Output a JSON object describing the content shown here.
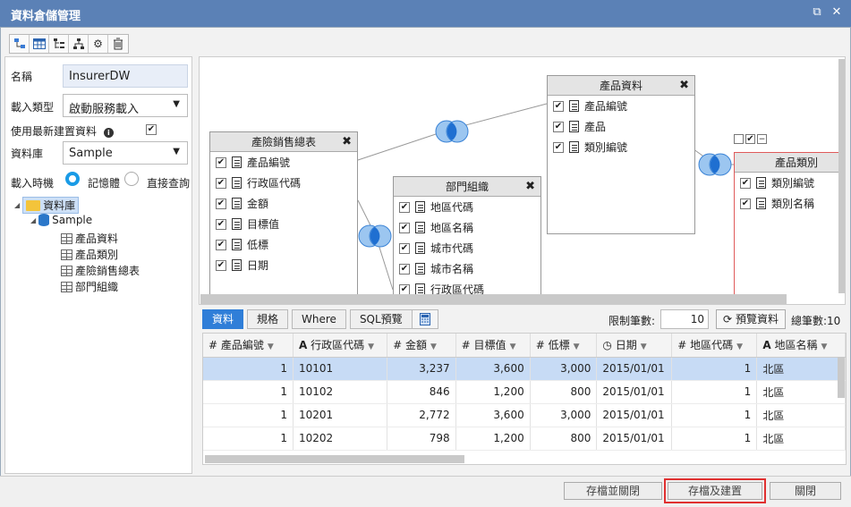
{
  "window": {
    "title": "資料倉儲管理"
  },
  "toolbar": {
    "icons": [
      "diagram-icon",
      "table-icon",
      "tree-icon",
      "hierarchy-icon",
      "gear-icon",
      "trash-icon"
    ]
  },
  "form": {
    "name_label": "名稱",
    "name_value": "InsurerDW",
    "load_type_label": "載入類型",
    "load_type_value": "啟動服務載入",
    "use_latest_label": "使用最新建置資料",
    "use_latest_checked": true,
    "database_label": "資料庫",
    "database_value": "Sample",
    "load_time_label": "載入時機",
    "radio_memory": "記憶體",
    "radio_direct": "直接查詢"
  },
  "tree": {
    "root": "資料庫",
    "db": "Sample",
    "tables": [
      "產品資料",
      "產品類別",
      "產險銷售總表",
      "部門組織"
    ]
  },
  "entities": {
    "sales": {
      "title": "產險銷售總表",
      "fields": [
        "產品編號",
        "行政區代碼",
        "金額",
        "目標值",
        "低標",
        "日期"
      ]
    },
    "dept": {
      "title": "部門組織",
      "fields": [
        "地區代碼",
        "地區名稱",
        "城市代碼",
        "城市名稱",
        "行政區代碼"
      ]
    },
    "product": {
      "title": "產品資料",
      "fields": [
        "產品編號",
        "產品",
        "類別編號"
      ]
    },
    "category": {
      "title": "產品類別",
      "fields": [
        "類別編號",
        "類別名稱"
      ]
    }
  },
  "tabs": [
    "資料",
    "規格",
    "Where",
    "SQL預覽"
  ],
  "limit": {
    "label": "限制筆數:",
    "value": "10"
  },
  "preview_button": "預覽資料",
  "total": "總筆數:10",
  "grid": {
    "columns": [
      {
        "icon": "#",
        "label": "產品編號"
      },
      {
        "icon": "A",
        "label": "行政區代碼"
      },
      {
        "icon": "#",
        "label": "金額"
      },
      {
        "icon": "#",
        "label": "目標值"
      },
      {
        "icon": "#",
        "label": "低標"
      },
      {
        "icon": "◷",
        "label": "日期"
      },
      {
        "icon": "#",
        "label": "地區代碼"
      },
      {
        "icon": "A",
        "label": "地區名稱"
      }
    ],
    "rows": [
      [
        "1",
        "10101",
        "3,237",
        "3,600",
        "3,000",
        "2015/01/01",
        "1",
        "北區"
      ],
      [
        "1",
        "10102",
        "846",
        "1,200",
        "800",
        "2015/01/01",
        "1",
        "北區"
      ],
      [
        "1",
        "10201",
        "2,772",
        "3,600",
        "3,000",
        "2015/01/01",
        "1",
        "北區"
      ],
      [
        "1",
        "10202",
        "798",
        "1,200",
        "800",
        "2015/01/01",
        "1",
        "北區"
      ]
    ]
  },
  "footer": {
    "save_close": "存檔並關閉",
    "save_build": "存檔及建置",
    "close": "關閉"
  }
}
